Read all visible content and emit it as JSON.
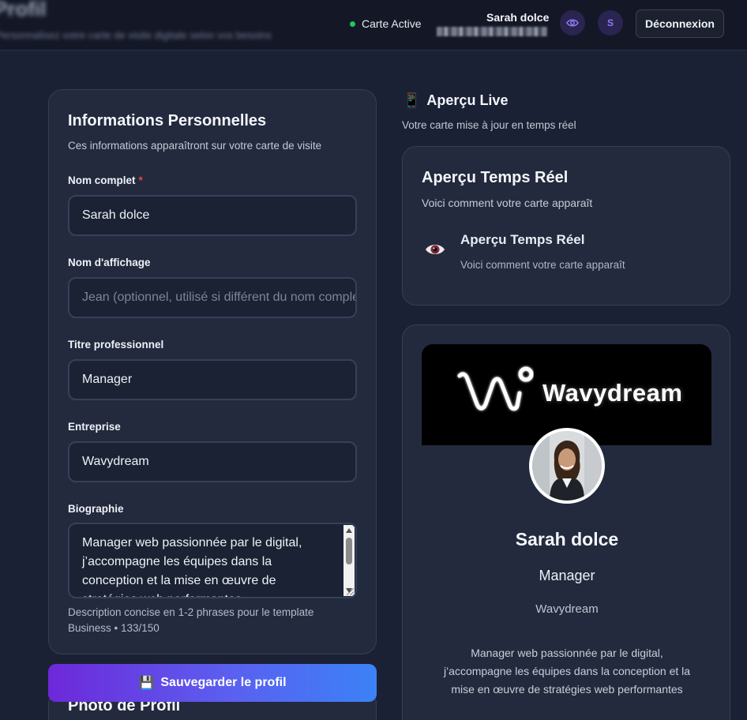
{
  "header": {
    "page_title": "Profil",
    "page_subtitle": "Personnalisez votre carte de visite digitale selon vos besoins",
    "status_label": "Carte Active",
    "user_name": "Sarah dolce",
    "avatar_initial": "S",
    "logout_label": "Déconnexion"
  },
  "form": {
    "title": "Informations Personnelles",
    "description": "Ces informations apparaîtront sur votre carte de visite",
    "full_name": {
      "label": "Nom complet",
      "required_mark": "*",
      "value": "Sarah dolce"
    },
    "display_name": {
      "label": "Nom d'affichage",
      "placeholder": "Jean (optionnel, utilisé si différent du nom complet)"
    },
    "job_title": {
      "label": "Titre professionnel",
      "value": "Manager"
    },
    "company": {
      "label": "Entreprise",
      "value": "Wavydream"
    },
    "bio": {
      "label": "Biographie",
      "value": "Manager web passionnée par le digital, j’accompagne les équipes dans la conception et la mise en œuvre de stratégies web performantes",
      "helper": "Description concise en 1-2 phrases pour le template Business • 133/150"
    },
    "save_icon": "💾",
    "save_label": "Sauvegarder le profil",
    "photo_section_title": "Photo de Profil"
  },
  "preview": {
    "live_icon": "📱",
    "live_title": "Aperçu Live",
    "live_subtitle": "Votre carte mise à jour en temps réel",
    "card_title": "Aperçu Temps Réel",
    "card_subtitle": "Voici comment votre carte apparaît",
    "inner_title": "Aperçu Temps Réel",
    "inner_subtitle": "Voici comment votre carte apparaît"
  },
  "business_card": {
    "banner_brand": "Wavydream",
    "name": "Sarah dolce",
    "role": "Manager",
    "company": "Wavydream",
    "bio": "Manager web passionnée par le digital, j’accompagne les équipes dans la conception et la mise en œuvre de stratégies web performantes"
  },
  "icons": {
    "eye": "eye-icon",
    "save": "floppy-disk-icon",
    "live": "mobile-phone-icon",
    "status": "green-dot-icon"
  },
  "colors": {
    "background": "#1b2134",
    "card": "#232a3d",
    "accent_start": "#6d28d9",
    "accent_end": "#3b82f6",
    "status_green": "#22c55e",
    "required_red": "#ef4444"
  }
}
